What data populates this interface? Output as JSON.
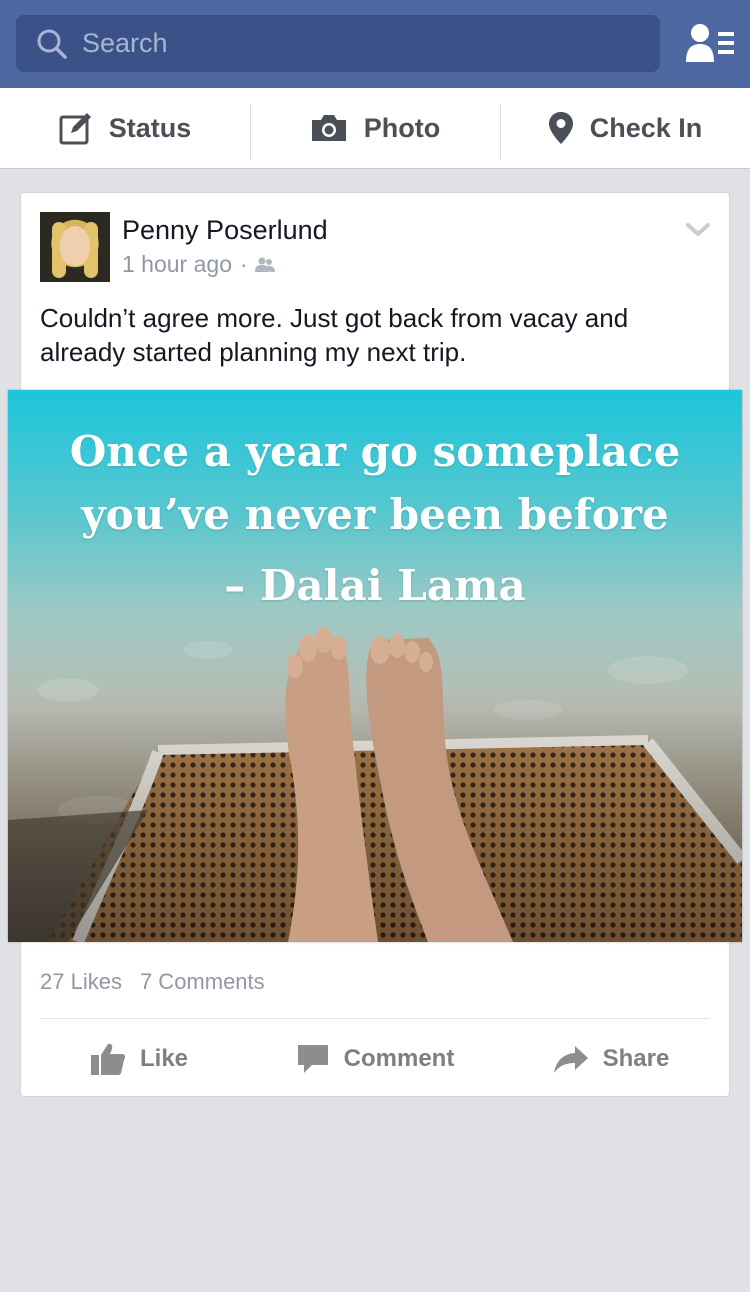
{
  "search": {
    "placeholder": "Search"
  },
  "composer": {
    "status_label": "Status",
    "photo_label": "Photo",
    "checkin_label": "Check In"
  },
  "post": {
    "author": "Penny Poserlund",
    "time": "1 hour ago",
    "separator": "·",
    "text": "Couldn’t agree more. Just got back from vacay and already started planning my next trip.",
    "image_quote_line1": "Once a year go someplace",
    "image_quote_line2": "you’ve never been before",
    "image_quote_author": "– Dalai Lama",
    "likes": "27 Likes",
    "comments": "7 Comments"
  },
  "actions": {
    "like": "Like",
    "comment": "Comment",
    "share": "Share"
  },
  "colors": {
    "brand_blue": "#4e69a2",
    "search_bg": "#3b5288",
    "feed_bg": "#dfe1e6"
  }
}
